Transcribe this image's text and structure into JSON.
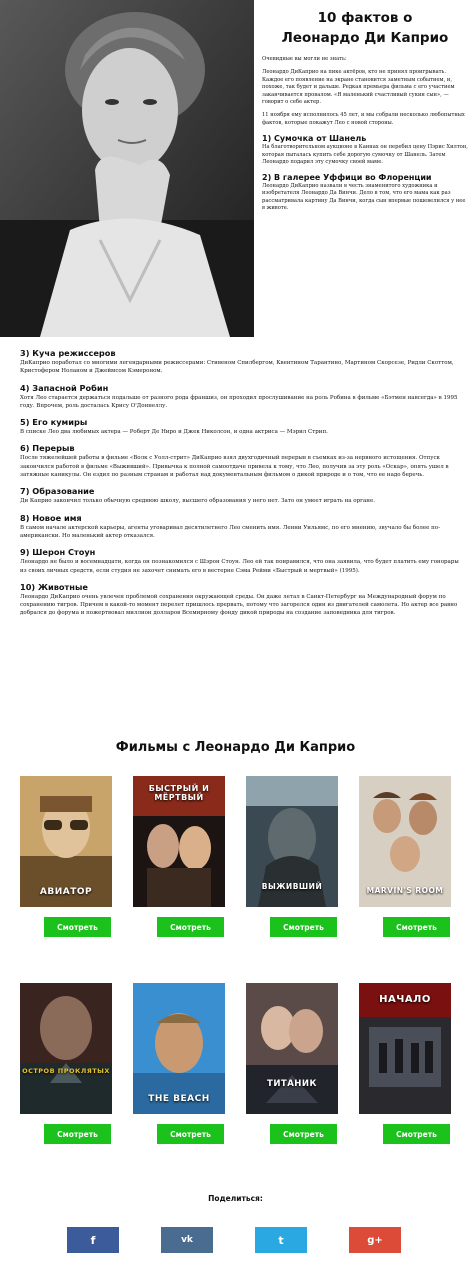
{
  "header": {
    "title_line1": "10 фактов о",
    "title_line2": "Леонардо Ди Каприо"
  },
  "intro": [
    "Очевидные вы могли не знать:",
    "Леонардо ДиКаприо на пике актёров, кто не принял проигрывать. Каждое его появление на экране становится заметным событием, и, похоже, так будет и дальше. Редкая премьера фильма с его участием заканчивается провалом. «Я маленький счастливый сукин сын», — говорит о себе актер.",
    "11 ноября ему исполнилось 45 лет, и мы собрали несколько любопытных фактов, которые покажут Лео с новой стороны."
  ],
  "facts": [
    {
      "title": "1) Сумочка от Шанель",
      "text": "На благотворительном аукционе в Каннах он перебил цену Пэрис Хилтон, которая пыталась купить себе дорогую сумочку от Шанель. Затем Леонардо подарил эту сумочку своей маме."
    },
    {
      "title": "2) В галерее Уффици во Флоренции",
      "text": "Леонардо ДиКаприо назвали в честь знаменитого художника и изобретателя Леонардо Да Винчи. Дело в том, что его мама как раз рассматривала картину Да Винчи, когда сын впервые пошевелился у нее в животе."
    },
    {
      "title": "3) Куча режиссеров",
      "text": "ДиКаприо поработал со многими легендарными режиссерами: Стивеном Спилбергом, Квентином Тарантино, Мартином Скорсезе, Ридли Скоттом, Кристофером Ноланом и Джеймсом Кэмероном."
    },
    {
      "title": "4) Запасной Робин",
      "text": "Хотя Лео старается держаться подальше от разного рода франшиз, он проходил прослушивание на роль Робина в фильме «Бэтмен навсегда» в 1995 году. Впрочем, роль досталась Крису О'Доннеллу."
    },
    {
      "title": "5) Его кумиры",
      "text": "В списке Лео два любимых актера — Роберт Де Ниро и Джек Николсон, и одна актриса — Мэрил Стрип."
    },
    {
      "title": "6) Перерыв",
      "text": "После тяжелейшей работы в фильме «Волк с Уолл-стрит» ДиКаприо взял двухгодичный перерыв в съемках из-за нервного истощения. Отпуск закончился работой в фильме «Выживший». Привычка к полной самоотдаче привела к тому, что Лео, получив за эту роль «Оскар», опять ушел в затяжные каникулы. Он ездил по разным странам и работал над документальным фильмом о дикой природе и о том, что ее надо беречь."
    },
    {
      "title": "7) Образование",
      "text": "Ди Каприо закончил только обычную среднюю школу, высшего образования у него нет. Зато он умеет играть на органе."
    },
    {
      "title": "8) Новое имя",
      "text": "В самом начале актерской карьеры, агенты уговаривал десятилетнего Лео сменить имя. Ленни Уильямс, по его мнению, звучало бы более по-американски. Но маленький актер отказался."
    },
    {
      "title": "9) Шерон Стоун",
      "text": "Леонардо не было и восемнадцати, когда он познакомился с Шэрон Стоун. Лео ей так понравился, что она заявила, что будет платить ему гонорары из своих личных средств, если студия не захочет снимать его в вестерне Сэма Рейми «Быстрый и мертвый» (1995)."
    },
    {
      "title": "10) Животные",
      "text": "Леонардо ДиКаприо очень увлечен проблемой сохранения окружающей среды. Он даже летал в Санкт-Петербург на Международный форум по сохранению тигров. Причем в какой-то момент перелет пришлось прервать, потому что загорелся один из двигателей самолета. Но актер все равно добрался до форума и пожертвовал миллион долларов Всемирному фонду дикой природы на создание заповедника для тигров."
    }
  ],
  "films_section": {
    "title": "Фильмы с Леонардо Ди Каприо",
    "watch_label": "Смотреть",
    "posters": [
      {
        "title": "АВИАТОР",
        "color": "#c9a46a"
      },
      {
        "title": "БЫСТРЫЙ И МЁРТВЫЙ",
        "color": "#8a2a1a"
      },
      {
        "title": "ВЫЖИВШИЙ",
        "color": "#3b4a52"
      },
      {
        "title": "MARVIN'S ROOM",
        "color": "#d8cfc3"
      },
      {
        "title": "ОСТРОВ ПРОКЛЯТЫХ",
        "color": "#3a2420"
      },
      {
        "title": "THE BEACH",
        "color": "#3a8fd0"
      },
      {
        "title": "ТИТАНИК",
        "color": "#5a4a48"
      },
      {
        "title": "НАЧАЛО",
        "color": "#7a1010"
      }
    ]
  },
  "share": {
    "label": "Поделиться:",
    "buttons": [
      {
        "glyph": "f",
        "color": "#3b5b9b",
        "icon": "facebook-icon"
      },
      {
        "glyph": "vk",
        "color": "#4b6c91",
        "icon": "vk-icon"
      },
      {
        "glyph": "t",
        "color": "#2aa8e2",
        "icon": "twitter-icon"
      },
      {
        "glyph": "g+",
        "color": "#dc4a38",
        "icon": "google-plus-icon"
      }
    ]
  }
}
